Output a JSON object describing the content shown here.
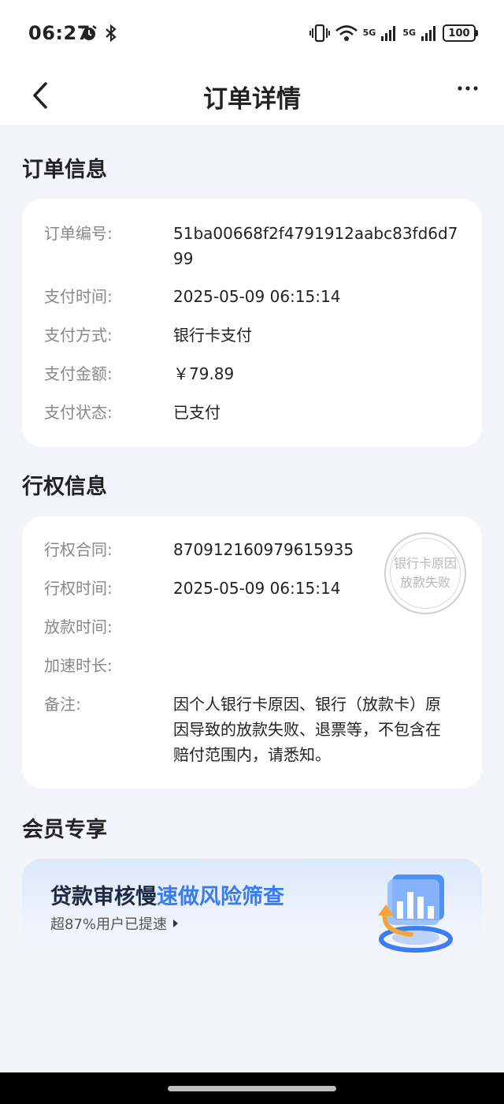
{
  "status_bar": {
    "time": "06:27",
    "battery": "100",
    "network_1": "5G",
    "network_2": "5G"
  },
  "nav": {
    "title": "订单详情",
    "back_icon": "chevron-left-icon",
    "more_icon": "more-dots-icon"
  },
  "order_section": {
    "title": "订单信息",
    "rows": [
      {
        "label": "订单编号:",
        "value": "51ba00668f2f4791912aabc83fd6d799"
      },
      {
        "label": "支付时间:",
        "value": "2025-05-09 06:15:14"
      },
      {
        "label": "支付方式:",
        "value": "银行卡支付"
      },
      {
        "label": "支付金额:",
        "value": "￥79.89"
      },
      {
        "label": "支付状态:",
        "value": "已支付"
      }
    ]
  },
  "right_section": {
    "title": "行权信息",
    "rows": [
      {
        "label": "行权合同:",
        "value": "870912160979615935"
      },
      {
        "label": "行权时间:",
        "value": "2025-05-09 06:15:14"
      },
      {
        "label": "放款时间:",
        "value": ""
      },
      {
        "label": "加速时长:",
        "value": ""
      },
      {
        "label": "备注:",
        "value": "因个人银行卡原因、银行（放款卡）原因导致的放款失败、退票等，不包含在赔付范围内，请悉知。"
      }
    ],
    "stamp": {
      "line1": "银行卡原因",
      "line2": "放款失败"
    }
  },
  "member_section": {
    "title": "会员专享",
    "promo": {
      "title_dark": "贷款审核慢",
      "title_blue": "速做风险筛查",
      "subtitle": "超87%用户已提速"
    }
  },
  "colors": {
    "background": "#f3f5fa",
    "accent_blue": "#3a7bf0",
    "label_gray": "#888888"
  }
}
